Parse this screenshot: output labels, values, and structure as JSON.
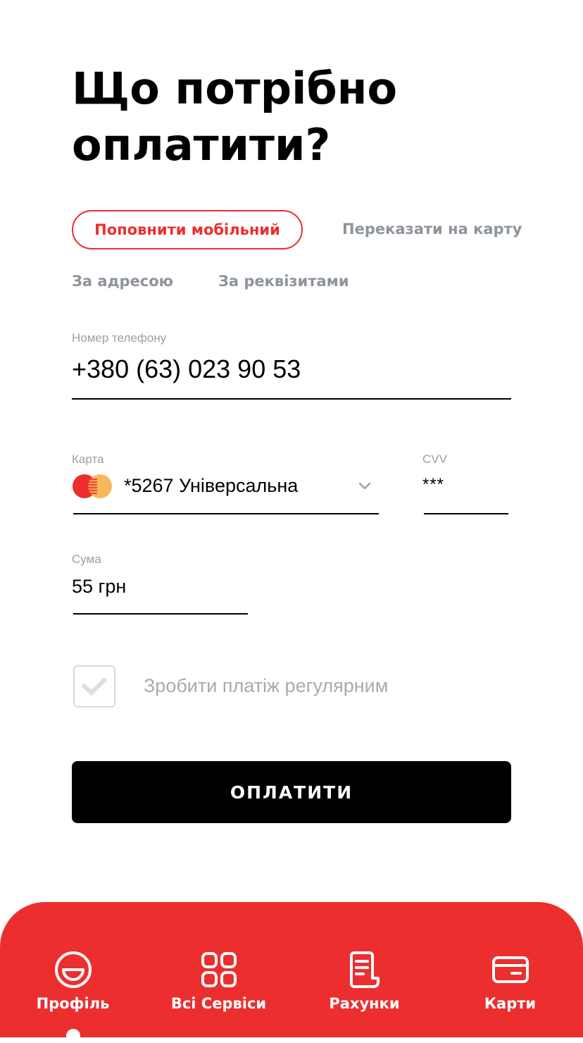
{
  "header": {
    "title_line1": "Що потрібно",
    "title_line2": "оплатити?"
  },
  "tabs": [
    {
      "label": "Поповнити мобільний",
      "active": true
    },
    {
      "label": "Переказати на карту",
      "active": false
    },
    {
      "label": "За адресою",
      "active": false
    },
    {
      "label": "За реквізитами",
      "active": false
    }
  ],
  "form": {
    "phone": {
      "label": "Номер телефону",
      "value": "+380 (63) 023 90 53"
    },
    "card": {
      "label": "Карта",
      "value": "*5267 Універсальна",
      "icon": "mastercard-icon"
    },
    "cvv": {
      "label": "CVV",
      "value": "***"
    },
    "amount": {
      "label": "Сума",
      "value": "55 грн"
    },
    "regular": {
      "label": "Зробити платіж регулярним",
      "checked": false
    }
  },
  "pay_button": {
    "label": "ОПЛАТИТИ"
  },
  "bottom_nav": {
    "items": [
      {
        "label": "Профіль",
        "icon": "smile-icon",
        "active": true
      },
      {
        "label": "Всі Сервіси",
        "icon": "grid-icon",
        "active": false
      },
      {
        "label": "Рахунки",
        "icon": "receipt-icon",
        "active": false
      },
      {
        "label": "Карти",
        "icon": "card-icon",
        "active": false
      }
    ]
  },
  "colors": {
    "accent": "#ec2e2f",
    "muted": "#8e949c",
    "button": "#000000"
  }
}
